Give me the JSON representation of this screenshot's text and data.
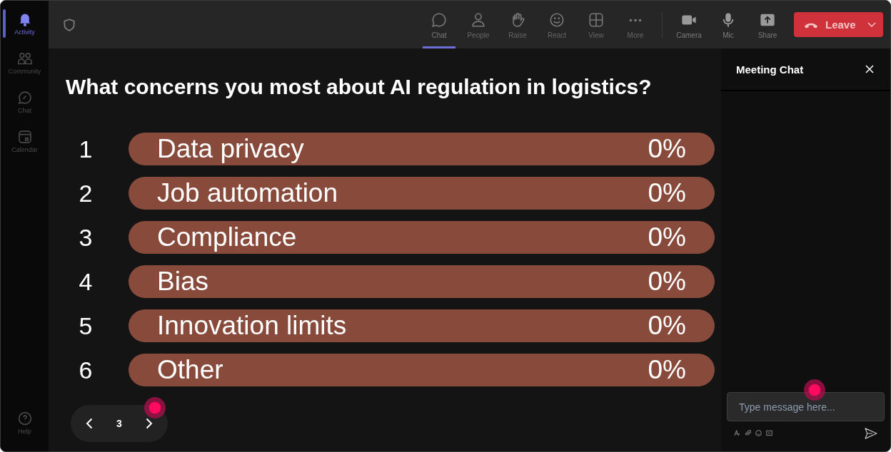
{
  "sidebar": {
    "items": [
      {
        "label": "Activity",
        "selected": true
      },
      {
        "label": "Community",
        "selected": false
      },
      {
        "label": "Chat",
        "selected": false
      },
      {
        "label": "Calendar",
        "selected": false
      }
    ],
    "help": {
      "label": "Help"
    }
  },
  "toolbar": {
    "views": [
      {
        "label": "Chat",
        "selected": true
      },
      {
        "label": "People",
        "selected": false
      },
      {
        "label": "Raise",
        "selected": false
      },
      {
        "label": "React",
        "selected": false
      },
      {
        "label": "View",
        "selected": false
      },
      {
        "label": "More",
        "selected": false
      }
    ],
    "devices": [
      {
        "label": "Camera"
      },
      {
        "label": "Mic"
      },
      {
        "label": "Share"
      }
    ],
    "leave": {
      "label": "Leave"
    }
  },
  "poll": {
    "question": "What concerns you most about AI regulation in logistics?",
    "options": [
      {
        "number": "1",
        "label": "Data privacy",
        "percent": "0%"
      },
      {
        "number": "2",
        "label": "Job automation",
        "percent": "0%"
      },
      {
        "number": "3",
        "label": "Compliance",
        "percent": "0%"
      },
      {
        "number": "4",
        "label": "Bias",
        "percent": "0%"
      },
      {
        "number": "5",
        "label": "Innovation limits",
        "percent": "0%"
      },
      {
        "number": "6",
        "label": "Other",
        "percent": "0%"
      }
    ]
  },
  "pager": {
    "page": "3"
  },
  "chat": {
    "title": "Meeting Chat",
    "input": {
      "placeholder": "Type message here..."
    }
  }
}
